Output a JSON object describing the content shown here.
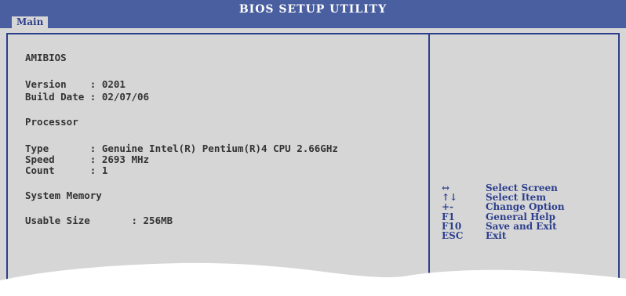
{
  "header": {
    "title": "BIOS SETUP UTILITY",
    "active_tab": "Main"
  },
  "info": {
    "heading": "AMIBIOS",
    "version_label": "Version    :",
    "version_value": "0201",
    "build_label": "Build Date :",
    "build_value": "02/07/06",
    "processor_heading": "Processor",
    "type_label": "Type       :",
    "type_value": "Genuine Intel(R) Pentium(R)4 CPU 2.66GHz",
    "speed_label": "Speed      :",
    "speed_value": "2693 MHz",
    "count_label": "Count      :",
    "count_value": "1",
    "memory_heading": "System Memory",
    "usable_label": "Usable Size       :",
    "usable_value": "256MB"
  },
  "help": [
    {
      "key": "↔",
      "desc": "Select Screen"
    },
    {
      "key": "↑↓",
      "desc": "Select Item"
    },
    {
      "key": "+-",
      "desc": "Change Option"
    },
    {
      "key": "F1",
      "desc": "General Help"
    },
    {
      "key": "F10",
      "desc": "Save and Exit"
    },
    {
      "key": "ESC",
      "desc": "Exit"
    }
  ]
}
